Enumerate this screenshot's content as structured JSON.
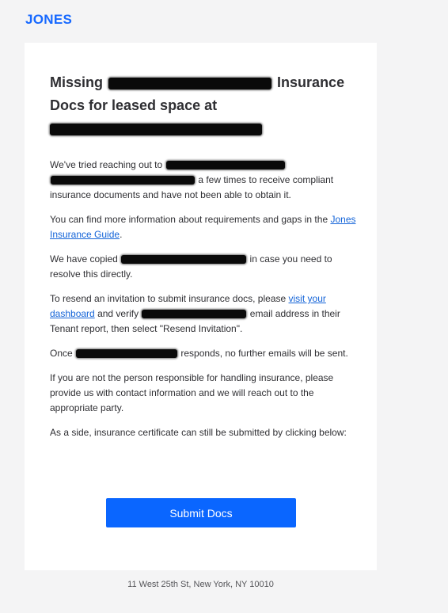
{
  "brand": {
    "logo_text": "JONES",
    "accent": "#0a66ff"
  },
  "email": {
    "title_part1": "Missing",
    "title_part2": "Insurance",
    "title_part3": "Docs for leased space at",
    "p1_a": "We've tried reaching out to",
    "p1_b": "a few times to receive compliant insurance documents and have not been able to obtain it.",
    "p2_a": "You can find more information about requirements and gaps in the",
    "p2_link": "Jones Insurance Guide",
    "p2_b": ".",
    "p3_a": "We have copied",
    "p3_b": "in case you need to resolve this directly.",
    "p4_a": "To resend an invitation to submit insurance docs, please",
    "p4_link": "visit your dashboard",
    "p4_b": "and verify",
    "p4_c": "email address in their Tenant report, then select \"Resend Invitation\".",
    "p5_a": "Once",
    "p5_b": "responds, no further emails will be sent.",
    "p6": "If you are not the person responsible for handling insurance, please provide us with contact information and we will reach out to the appropriate party.",
    "p7": "As a side, insurance certificate can still be submitted by clicking below:",
    "button_label": "Submit Docs"
  },
  "footer": {
    "address": "11 West 25th St, New York, NY 10010"
  }
}
